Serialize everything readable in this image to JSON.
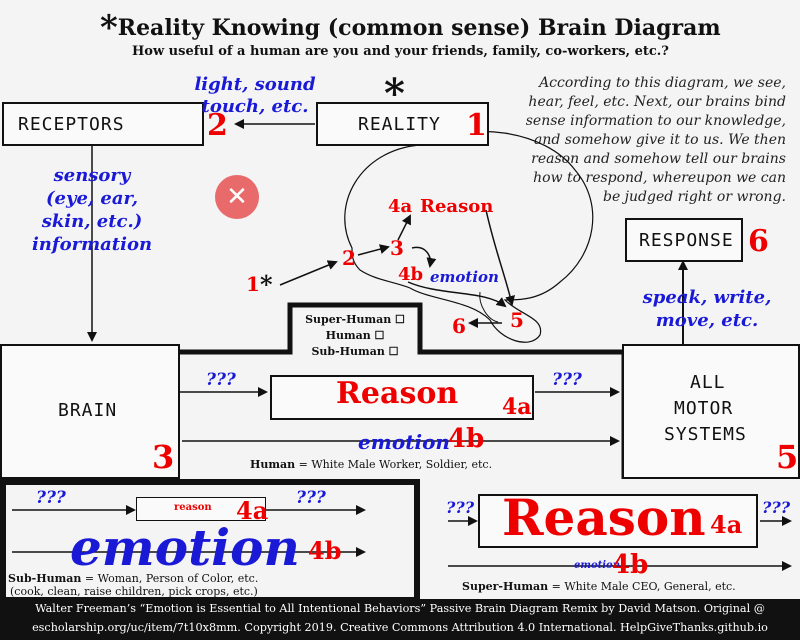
{
  "header": {
    "title_star": "*",
    "title": "Reality Knowing (common sense) Brain Diagram",
    "subtitle": "How useful of a human are you and your friends, family, co-workers, etc.?"
  },
  "description": "According to this diagram, we see, hear, feel, etc.  Next, our brains bind sense information to our knowledge, and somehow give it to us.  We then reason and somehow tell our brains how to respond, whereupon we can be judged right or wrong.",
  "boxes": {
    "receptors": {
      "label": "RECEPTORS",
      "num": "2"
    },
    "reality": {
      "label": "REALITY",
      "num": "1",
      "star": "*"
    },
    "response": {
      "label": "RESPONSE",
      "num": "6"
    },
    "brain": {
      "label": "BRAIN",
      "num": "3"
    },
    "motor": {
      "line1": "ALL",
      "line2": "MOTOR",
      "line3": "SYSTEMS",
      "num": "5"
    }
  },
  "labels": {
    "light_line1": "light, sound",
    "light_line2": "touch, etc.",
    "sensory_line1": "sensory",
    "sensory_line2": "(eye, ear,",
    "sensory_line3": "skin, etc.)",
    "sensory_line4": "information",
    "speak_line1": "speak, write,",
    "speak_line2": "move, etc."
  },
  "brain_sketch": {
    "n1": "1",
    "n1_star": "*",
    "n2": "2",
    "n3": "3",
    "n4a": "4a",
    "reason": "Reason",
    "n4b": "4b",
    "emotion": "emotion",
    "n5": "5",
    "n6": "6"
  },
  "checklist": {
    "super": "Super-Human ☐",
    "human": "Human ☐",
    "sub": "Sub-Human ☐"
  },
  "human_section": {
    "qmarks_left": "???",
    "qmarks_right": "???",
    "reason": "Reason",
    "num4a": "4a",
    "emotion": "emotion",
    "num4b": "4b",
    "caption_bold": "Human",
    "caption": " = White Male Worker, Soldier, etc."
  },
  "sub_human_section": {
    "qmarks_left": "???",
    "qmarks_right": "???",
    "reason": "reason",
    "num4a": "4a",
    "emotion": "emotion",
    "num4b": "4b",
    "caption_bold": "Sub-Human",
    "caption": " = Woman, Person of Color, etc.",
    "caption2": "(cook, clean, raise children, pick crops, etc.)"
  },
  "super_human_section": {
    "qmarks_left": "???",
    "qmarks_right": "???",
    "reason": "Reason",
    "num4a": "4a",
    "emotion": "emotion",
    "num4b": "4b",
    "caption_bold": "Super-Human",
    "caption": " = White Male CEO, General, etc."
  },
  "footer": {
    "line1": "Walter Freeman’s  “Emotion is Essential to All Intentional Behaviors”  Passive Brain Diagram Remix by David Matson.   Original @",
    "line2": "escholarship.org/uc/item/7t10x8mm. Copyright 2019. Creative Commons Attribution 4.0 International. HelpGiveThanks.github.io"
  },
  "colors": {
    "red": "#e00000",
    "blue": "#1a1ad6",
    "close_button": "#e96a6a"
  }
}
